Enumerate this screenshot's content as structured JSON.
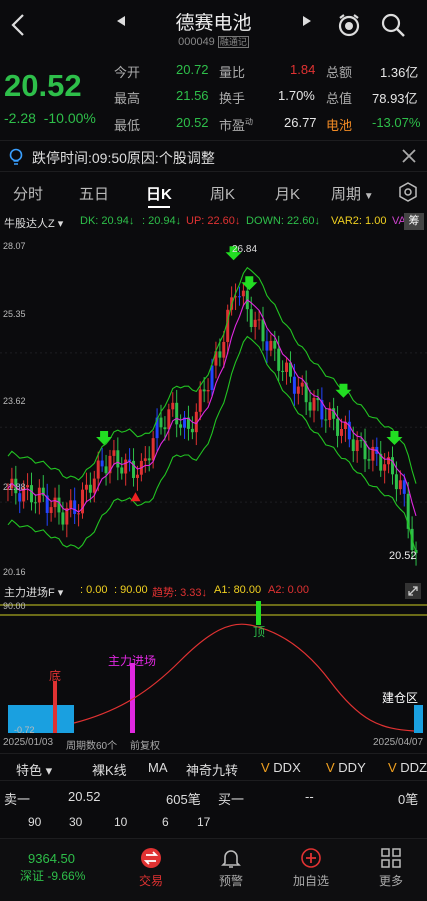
{
  "header": {
    "back_icon": "chevron-left-icon",
    "title": "德赛电池",
    "code": "000049",
    "code_tag": "融通记",
    "prev_icon": "triangle-left-icon",
    "next_icon": "triangle-right-icon",
    "alarm_icon": "alarm-clock-icon",
    "search_icon": "search-icon"
  },
  "quote": {
    "price": "20.52",
    "change": "-2.28",
    "change_pct": "-10.00%",
    "open_label": "今开",
    "open": "20.72",
    "high_label": "最高",
    "high": "21.56",
    "low_label": "最低",
    "low": "20.52",
    "vol_ratio_label": "量比",
    "vol_ratio": "1.84",
    "turnover_label": "换手",
    "turnover": "1.70%",
    "pe_label": "市盈",
    "pe_sup": "动",
    "pe": "26.77",
    "amount_label": "总额",
    "amount": "1.36亿",
    "mcap_label": "总值",
    "mcap": "78.93亿",
    "sector": "电池",
    "sector_pct": "-13.07%"
  },
  "notice": {
    "text": "跌停时间:09:50原因:个股调整",
    "bulb_icon": "lightbulb-icon",
    "close_icon": "close-icon"
  },
  "tabs": [
    {
      "label": "分时"
    },
    {
      "label": "五日"
    },
    {
      "label": "日K"
    },
    {
      "label": "周K"
    },
    {
      "label": "月K"
    },
    {
      "label": "周期"
    }
  ],
  "tabs_extra": {
    "dropdown_icon": "caret-down-icon",
    "settings_icon": "hexagon-settings-icon"
  },
  "indicator": {
    "name": "牛股达人Z",
    "dk": "DK: 20.94↓",
    "v2": ": 20.94↓",
    "up": "UP: 22.60↓",
    "down": "DOWN: 22.60↓",
    "var2": "VAR2: 1.00",
    "va": "VA",
    "badge": "筹"
  },
  "main_chart": {
    "y_labels": [
      "28.07",
      "25.35",
      "23.62",
      "21.88",
      "20.16"
    ],
    "high_mark": "26.84",
    "last_price": "20.52"
  },
  "sub_indicator": {
    "name": "主力进场F",
    "v1": ": 0.00",
    "v2": ": 90.00",
    "trend": "趋势: 3.33↓",
    "a1": "A1: 80.00",
    "a2": "A2: 0.00",
    "y_top": "90.00",
    "y_bot": "-0.72",
    "label_di": "底",
    "label_ding": "顶",
    "label_zljc": "主力进场",
    "label_jcq": "建仓区",
    "expand_icon": "expand-icon"
  },
  "date_row": {
    "start": "2025/01/03",
    "period": "周期数60个",
    "adjust": "前复权",
    "end": "2025/04/07"
  },
  "toolbar": [
    {
      "label": "特色",
      "dropdown": "▾"
    },
    {
      "label": "裸K线"
    },
    {
      "label": "MA"
    },
    {
      "label": "神奇九转"
    },
    {
      "label": "DDX",
      "badge": "V"
    },
    {
      "label": "DDY",
      "badge": "V"
    },
    {
      "label": "DDZ",
      "badge": "V"
    }
  ],
  "orderbook": {
    "sell1_label": "卖一",
    "sell1_price": "20.52",
    "sell1_vol": "605笔",
    "buy1_label": "买一",
    "buy1_price": "--",
    "buy1_vol": "0笔",
    "queue": [
      "90",
      "30",
      "10",
      "6",
      "17"
    ]
  },
  "nav": {
    "index_value": "9364.50",
    "index_name": "深证",
    "index_pct": "-9.66%",
    "items": [
      {
        "label": "交易",
        "icon": "trade-icon"
      },
      {
        "label": "预警",
        "icon": "bell-icon"
      },
      {
        "label": "加自选",
        "icon": "plus-circle-icon"
      },
      {
        "label": "更多",
        "icon": "grid-icon"
      }
    ]
  },
  "colors": {
    "up": "#e03232",
    "down": "#2ebf4a",
    "accent": "#f08a24",
    "ma_magenta": "#e028e0",
    "band_green": "#22c422",
    "blue": "#2244ff"
  }
}
